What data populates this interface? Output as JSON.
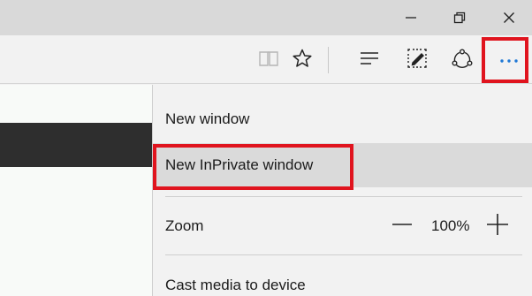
{
  "window": {
    "minimize_icon": "minimize-icon",
    "restore_icon": "restore-icon",
    "close_icon": "close-icon"
  },
  "toolbar": {
    "icons": [
      "reading-view-icon",
      "favorite-star-icon",
      "hub-icon",
      "web-note-icon",
      "share-icon",
      "more-actions-icon"
    ]
  },
  "menu": {
    "new_window": "New window",
    "new_inprivate_window": "New InPrivate window",
    "zoom_label": "Zoom",
    "zoom_value": "100%",
    "cast_media": "Cast media to device"
  },
  "colors": {
    "highlight_red": "#e0141e",
    "titlebar": "#d9d9d9",
    "toolbar": "#f2f2f2",
    "menu_hover": "#dadada",
    "more_icon_blue": "#1e78d6"
  }
}
